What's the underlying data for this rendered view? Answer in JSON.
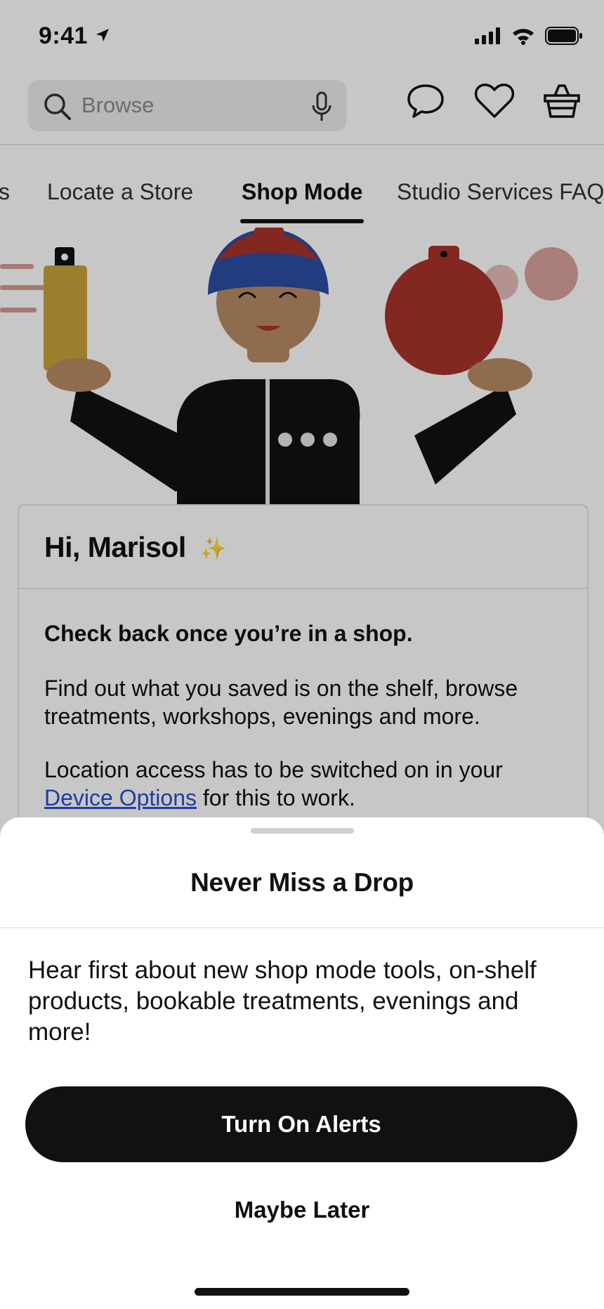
{
  "status_bar": {
    "time": "9:41"
  },
  "header": {
    "search_placeholder": "Browse"
  },
  "tabs": [
    {
      "label": "s"
    },
    {
      "label": "Locate a Store"
    },
    {
      "label": "Shop Mode"
    },
    {
      "label": "Studio Services FAQ"
    }
  ],
  "card": {
    "greeting": "Hi, Marisol",
    "sparkle": "✨",
    "heading": "Check back once you’re in a shop.",
    "paragraph1": "Find out what you saved is on the shelf, browse treatments, workshops, evenings and more.",
    "paragraph2_prefix": "Location access has to be switched on in your",
    "paragraph2_link": "Device Options",
    "paragraph2_suffix": " for this to work."
  },
  "sheet": {
    "title": "Never Miss a Drop",
    "body": "Hear first about new shop mode tools, on-shelf products, bookable treatments, evenings and more!",
    "primary_button": "Turn On Alerts",
    "secondary_button": "Maybe Later"
  },
  "colors": {
    "accent_dark": "#111111",
    "link": "#2a4fcf",
    "illus_red": "#a8332b",
    "illus_blue": "#2b4ea3",
    "illus_gold": "#c9a23a",
    "skin": "#b98b66"
  }
}
